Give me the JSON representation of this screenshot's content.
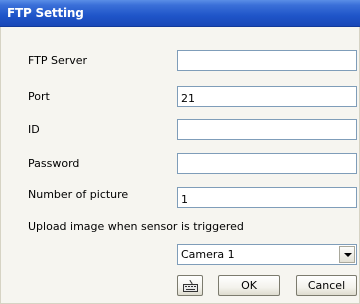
{
  "window": {
    "title": "FTP Setting"
  },
  "form": {
    "ftp_server": {
      "label": "FTP Server",
      "value": ""
    },
    "port": {
      "label": "Port",
      "value": "21"
    },
    "id": {
      "label": "ID",
      "value": ""
    },
    "password": {
      "label": "Password",
      "value": ""
    },
    "number_of_picture": {
      "label": "Number of picture",
      "value": "1"
    },
    "upload_trigger": {
      "label": "Upload image when sensor is triggered"
    },
    "camera_select": {
      "value": "Camera 1"
    }
  },
  "buttons": {
    "keyboard_icon": "keyboard-icon",
    "ok": "OK",
    "cancel": "Cancel"
  },
  "colors": {
    "titlebar": "#1f55c9",
    "background": "#f6f5f0",
    "field_border": "#7f9db9"
  }
}
